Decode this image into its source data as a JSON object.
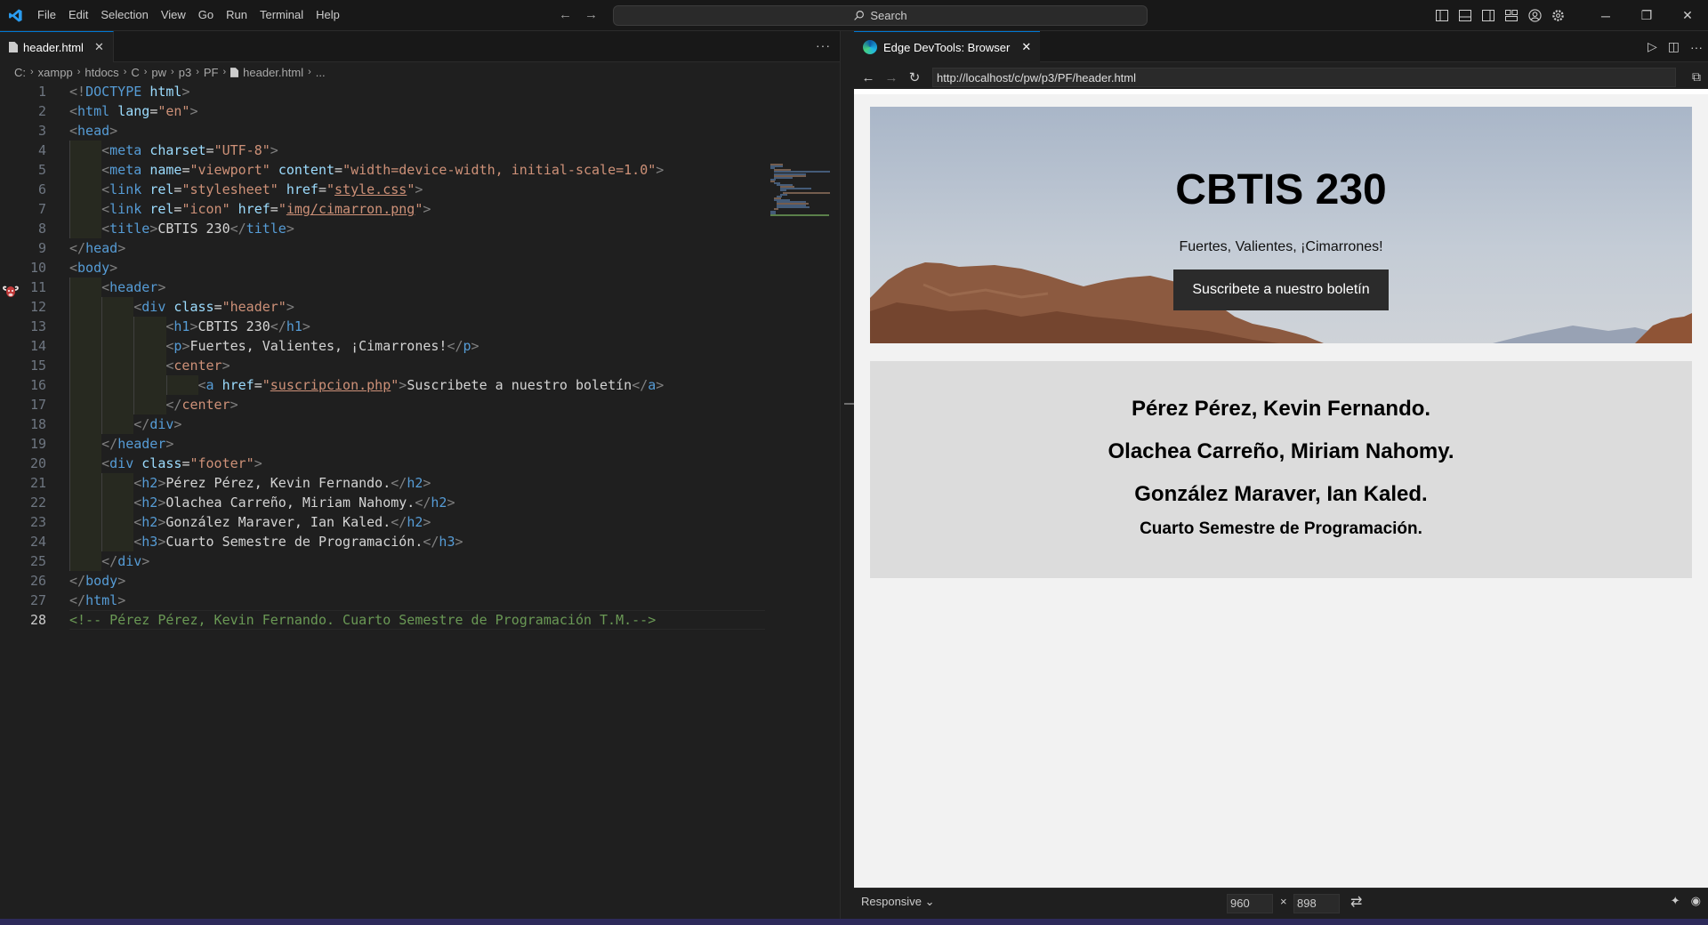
{
  "menu": [
    "File",
    "Edit",
    "Selection",
    "View",
    "Go",
    "Run",
    "Terminal",
    "Help"
  ],
  "search": {
    "label": "Search"
  },
  "editor": {
    "tab_label": "header.html",
    "breadcrumb": [
      "C:",
      "xampp",
      "htdocs",
      "C",
      "pw",
      "p3",
      "PF",
      "header.html",
      "..."
    ],
    "active_line": 28
  },
  "devtools": {
    "tab_label": "Edge DevTools: Browser",
    "url": "http://localhost/c/pw/p3/PF/header.html",
    "mode": "Responsive",
    "width": "960",
    "height": "898",
    "times": "×"
  },
  "site": {
    "h1": "CBTIS 230",
    "tagline": "Fuertes, Valientes, ¡Cimarrones!",
    "button": "Suscribete a nuestro boletín",
    "names": [
      "Pérez Pérez, Kevin Fernando.",
      "Olachea Carreño, Miriam Nahomy.",
      "González Maraver, Ian Kaled."
    ],
    "subtitle": "Cuarto Semestre de Programación."
  },
  "colors": {
    "accent": "#0078d4",
    "keyword": "#569cd6",
    "attribute": "#9cdcfe",
    "string": "#ce9178",
    "comment": "#6a9955"
  },
  "code": [
    {
      "tokens": [
        [
          "br",
          "<!"
        ],
        [
          "tg",
          "DOCTYPE"
        ],
        [
          "tx",
          " "
        ],
        [
          "at",
          "html"
        ],
        [
          "br",
          ">"
        ]
      ]
    },
    {
      "tokens": [
        [
          "br",
          "<"
        ],
        [
          "tg",
          "html"
        ],
        [
          "tx",
          " "
        ],
        [
          "at",
          "lang"
        ],
        [
          "tx",
          "="
        ],
        [
          "st",
          "\"en\""
        ],
        [
          "br",
          ">"
        ]
      ]
    },
    {
      "tokens": [
        [
          "br",
          "<"
        ],
        [
          "tg",
          "head"
        ],
        [
          "br",
          ">"
        ]
      ]
    },
    {
      "tokens": [
        [
          "tx",
          "    "
        ],
        [
          "br",
          "<"
        ],
        [
          "tg",
          "meta"
        ],
        [
          "tx",
          " "
        ],
        [
          "at",
          "charset"
        ],
        [
          "tx",
          "="
        ],
        [
          "st",
          "\"UTF-8\""
        ],
        [
          "br",
          ">"
        ]
      ]
    },
    {
      "tokens": [
        [
          "tx",
          "    "
        ],
        [
          "br",
          "<"
        ],
        [
          "tg",
          "meta"
        ],
        [
          "tx",
          " "
        ],
        [
          "at",
          "name"
        ],
        [
          "tx",
          "="
        ],
        [
          "st",
          "\"viewport\""
        ],
        [
          "tx",
          " "
        ],
        [
          "at",
          "content"
        ],
        [
          "tx",
          "="
        ],
        [
          "st",
          "\"width=device-width, initial-scale=1.0\""
        ],
        [
          "br",
          ">"
        ]
      ]
    },
    {
      "tokens": [
        [
          "tx",
          "    "
        ],
        [
          "br",
          "<"
        ],
        [
          "tg",
          "link"
        ],
        [
          "tx",
          " "
        ],
        [
          "at",
          "rel"
        ],
        [
          "tx",
          "="
        ],
        [
          "st",
          "\"stylesheet\""
        ],
        [
          "tx",
          " "
        ],
        [
          "at",
          "href"
        ],
        [
          "tx",
          "="
        ],
        [
          "st",
          "\""
        ],
        [
          "stu",
          "style.css"
        ],
        [
          "st",
          "\""
        ],
        [
          "br",
          ">"
        ]
      ]
    },
    {
      "tokens": [
        [
          "tx",
          "    "
        ],
        [
          "br",
          "<"
        ],
        [
          "tg",
          "link"
        ],
        [
          "tx",
          " "
        ],
        [
          "at",
          "rel"
        ],
        [
          "tx",
          "="
        ],
        [
          "st",
          "\"icon\""
        ],
        [
          "tx",
          " "
        ],
        [
          "at",
          "href"
        ],
        [
          "tx",
          "="
        ],
        [
          "st",
          "\""
        ],
        [
          "stu",
          "img/cimarron.png"
        ],
        [
          "st",
          "\""
        ],
        [
          "br",
          ">"
        ]
      ]
    },
    {
      "tokens": [
        [
          "tx",
          "    "
        ],
        [
          "br",
          "<"
        ],
        [
          "tg",
          "title"
        ],
        [
          "br",
          ">"
        ],
        [
          "tx",
          "CBTIS 230"
        ],
        [
          "br",
          "</"
        ],
        [
          "tg",
          "title"
        ],
        [
          "br",
          ">"
        ]
      ]
    },
    {
      "tokens": [
        [
          "br",
          "</"
        ],
        [
          "tg",
          "head"
        ],
        [
          "br",
          ">"
        ]
      ]
    },
    {
      "tokens": [
        [
          "br",
          "<"
        ],
        [
          "tg",
          "body"
        ],
        [
          "br",
          ">"
        ]
      ]
    },
    {
      "tokens": [
        [
          "tx",
          "    "
        ],
        [
          "br",
          "<"
        ],
        [
          "tg",
          "header"
        ],
        [
          "br",
          ">"
        ]
      ]
    },
    {
      "tokens": [
        [
          "tx",
          "        "
        ],
        [
          "br",
          "<"
        ],
        [
          "tg",
          "div"
        ],
        [
          "tx",
          " "
        ],
        [
          "at",
          "class"
        ],
        [
          "tx",
          "="
        ],
        [
          "st",
          "\"header\""
        ],
        [
          "br",
          ">"
        ]
      ]
    },
    {
      "tokens": [
        [
          "tx",
          "            "
        ],
        [
          "br",
          "<"
        ],
        [
          "tg",
          "h1"
        ],
        [
          "br",
          ">"
        ],
        [
          "tx",
          "CBTIS 230"
        ],
        [
          "br",
          "</"
        ],
        [
          "tg",
          "h1"
        ],
        [
          "br",
          ">"
        ]
      ]
    },
    {
      "tokens": [
        [
          "tx",
          "            "
        ],
        [
          "br",
          "<"
        ],
        [
          "tg",
          "p"
        ],
        [
          "br",
          ">"
        ],
        [
          "tx",
          "Fuertes, Valientes, ¡Cimarrones!"
        ],
        [
          "br",
          "</"
        ],
        [
          "tg",
          "p"
        ],
        [
          "br",
          ">"
        ]
      ]
    },
    {
      "tokens": [
        [
          "tx",
          "            "
        ],
        [
          "br",
          "<"
        ],
        [
          "st",
          "center"
        ],
        [
          "br",
          ">"
        ]
      ]
    },
    {
      "tokens": [
        [
          "tx",
          "                "
        ],
        [
          "br",
          "<"
        ],
        [
          "tg",
          "a"
        ],
        [
          "tx",
          " "
        ],
        [
          "at",
          "href"
        ],
        [
          "tx",
          "="
        ],
        [
          "st",
          "\""
        ],
        [
          "stu",
          "suscripcion.php"
        ],
        [
          "st",
          "\""
        ],
        [
          "br",
          ">"
        ],
        [
          "tx",
          "Suscribete a nuestro boletín"
        ],
        [
          "br",
          "</"
        ],
        [
          "tg",
          "a"
        ],
        [
          "br",
          ">"
        ]
      ]
    },
    {
      "tokens": [
        [
          "tx",
          "            "
        ],
        [
          "br",
          "</"
        ],
        [
          "st",
          "center"
        ],
        [
          "br",
          ">"
        ]
      ]
    },
    {
      "tokens": [
        [
          "tx",
          "        "
        ],
        [
          "br",
          "</"
        ],
        [
          "tg",
          "div"
        ],
        [
          "br",
          ">"
        ]
      ]
    },
    {
      "tokens": [
        [
          "tx",
          "    "
        ],
        [
          "br",
          "</"
        ],
        [
          "tg",
          "header"
        ],
        [
          "br",
          ">"
        ]
      ]
    },
    {
      "tokens": [
        [
          "tx",
          "    "
        ],
        [
          "br",
          "<"
        ],
        [
          "tg",
          "div"
        ],
        [
          "tx",
          " "
        ],
        [
          "at",
          "class"
        ],
        [
          "tx",
          "="
        ],
        [
          "st",
          "\"footer\""
        ],
        [
          "br",
          ">"
        ]
      ]
    },
    {
      "tokens": [
        [
          "tx",
          "        "
        ],
        [
          "br",
          "<"
        ],
        [
          "tg",
          "h2"
        ],
        [
          "br",
          ">"
        ],
        [
          "tx",
          "Pérez Pérez, Kevin Fernando."
        ],
        [
          "br",
          "</"
        ],
        [
          "tg",
          "h2"
        ],
        [
          "br",
          ">"
        ]
      ]
    },
    {
      "tokens": [
        [
          "tx",
          "        "
        ],
        [
          "br",
          "<"
        ],
        [
          "tg",
          "h2"
        ],
        [
          "br",
          ">"
        ],
        [
          "tx",
          "Olachea Carreño, Miriam Nahomy."
        ],
        [
          "br",
          "</"
        ],
        [
          "tg",
          "h2"
        ],
        [
          "br",
          ">"
        ]
      ]
    },
    {
      "tokens": [
        [
          "tx",
          "        "
        ],
        [
          "br",
          "<"
        ],
        [
          "tg",
          "h2"
        ],
        [
          "br",
          ">"
        ],
        [
          "tx",
          "González Maraver, Ian Kaled."
        ],
        [
          "br",
          "</"
        ],
        [
          "tg",
          "h2"
        ],
        [
          "br",
          ">"
        ]
      ]
    },
    {
      "tokens": [
        [
          "tx",
          "        "
        ],
        [
          "br",
          "<"
        ],
        [
          "tg",
          "h3"
        ],
        [
          "br",
          ">"
        ],
        [
          "tx",
          "Cuarto Semestre de Programación."
        ],
        [
          "br",
          "</"
        ],
        [
          "tg",
          "h3"
        ],
        [
          "br",
          ">"
        ]
      ]
    },
    {
      "tokens": [
        [
          "tx",
          "    "
        ],
        [
          "br",
          "</"
        ],
        [
          "tg",
          "div"
        ],
        [
          "br",
          ">"
        ]
      ]
    },
    {
      "tokens": [
        [
          "br",
          "</"
        ],
        [
          "tg",
          "body"
        ],
        [
          "br",
          ">"
        ]
      ]
    },
    {
      "tokens": [
        [
          "br",
          "</"
        ],
        [
          "tg",
          "html"
        ],
        [
          "br",
          ">"
        ]
      ]
    },
    {
      "tokens": [
        [
          "cm",
          "<!-- Pérez Pérez, Kevin Fernando. Cuarto Semestre de Programación T.M.-->"
        ]
      ]
    }
  ]
}
